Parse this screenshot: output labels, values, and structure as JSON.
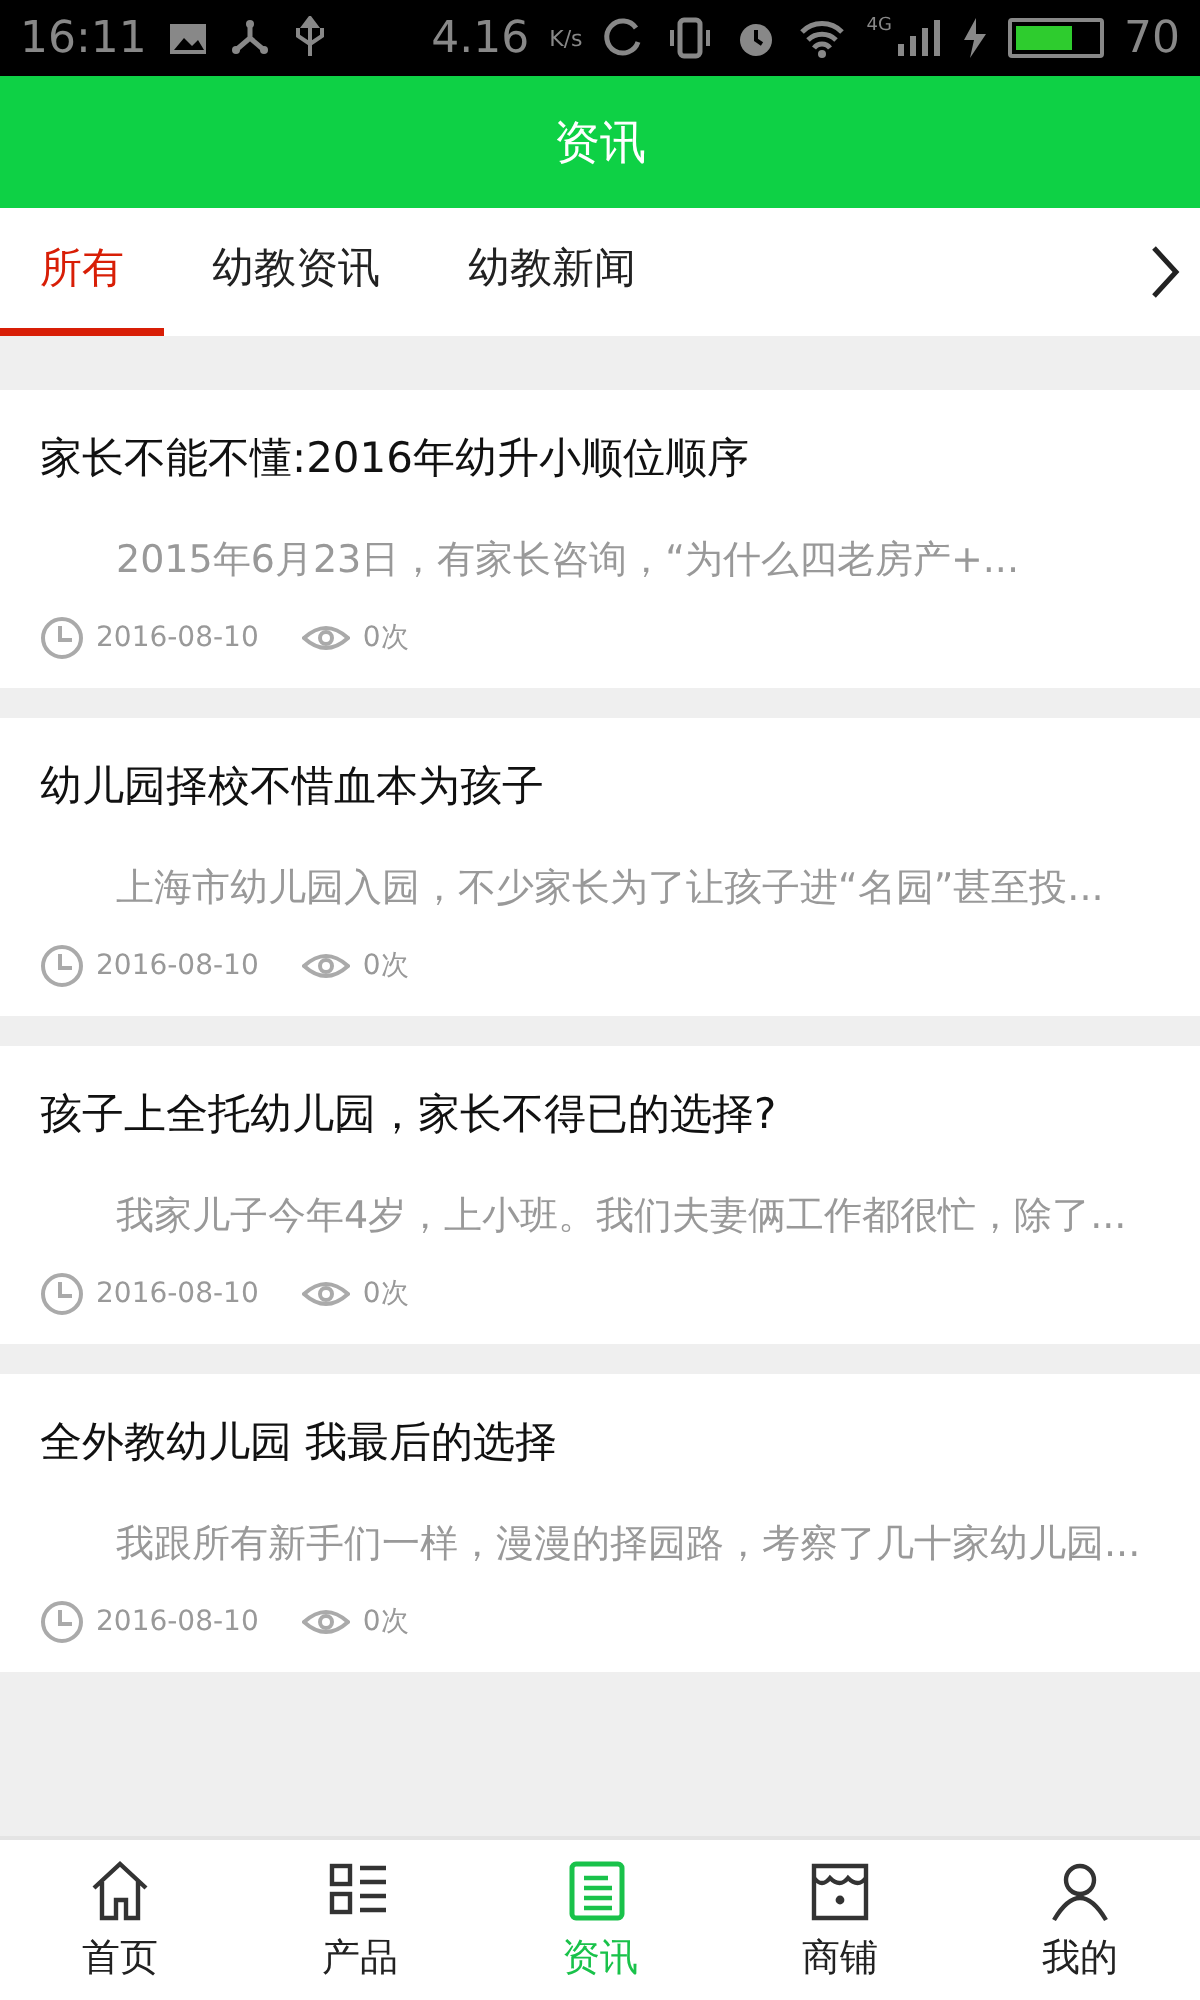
{
  "status_bar": {
    "time": "16:11",
    "speed": "4.16",
    "speed_unit": "K/s",
    "network": "4G",
    "battery": "70"
  },
  "header": {
    "title": "资讯"
  },
  "tabs": [
    {
      "label": "所有",
      "selected": true
    },
    {
      "label": "幼教资讯",
      "selected": false
    },
    {
      "label": "幼教新闻",
      "selected": false
    }
  ],
  "articles": [
    {
      "title": "家长不能不懂:2016年幼升小顺位顺序",
      "summary": "2015年6月23日，有家长咨询，“为什么四老房产+...",
      "date": "2016-08-10",
      "views": "0次"
    },
    {
      "title": "幼儿园择校不惜血本为孩子",
      "summary": "上海市幼儿园入园，不少家长为了让孩子进“名园”甚至投...",
      "date": "2016-08-10",
      "views": "0次"
    },
    {
      "title": "孩子上全托幼儿园，家长不得已的选择?",
      "summary": "我家儿子今年4岁，上小班。我们夫妻俩工作都很忙，除了...",
      "date": "2016-08-10",
      "views": "0次"
    },
    {
      "title": "全外教幼儿园 我最后的选择",
      "summary": "我跟所有新手们一样，漫漫的择园路，考察了几十家幼儿园...",
      "date": "2016-08-10",
      "views": "0次"
    }
  ],
  "bottom_nav": [
    {
      "label": "首页",
      "kind": "home",
      "selected": false
    },
    {
      "label": "产品",
      "kind": "list",
      "selected": false
    },
    {
      "label": "资讯",
      "kind": "news",
      "selected": true
    },
    {
      "label": "商铺",
      "kind": "shop",
      "selected": false
    },
    {
      "label": "我的",
      "kind": "user",
      "selected": false
    }
  ]
}
